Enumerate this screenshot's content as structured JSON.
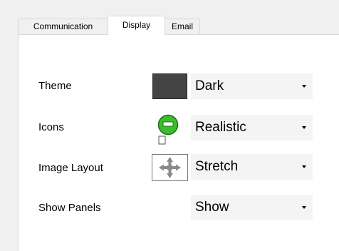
{
  "tabs": [
    {
      "label": "Communication",
      "active": false
    },
    {
      "label": "Display",
      "active": true
    },
    {
      "label": "Email",
      "active": false
    }
  ],
  "settings": {
    "theme": {
      "label": "Theme",
      "value": "Dark",
      "preview_color": "#444444"
    },
    "icons": {
      "label": "Icons",
      "value": "Realistic",
      "preview_icon": "green-monitor-icon"
    },
    "image_layout": {
      "label": "Image Layout",
      "value": "Stretch",
      "preview_icon": "stretch-arrows-icon"
    },
    "show_panels": {
      "label": "Show Panels",
      "value": "Show"
    }
  },
  "colors": {
    "window_background": "#f0f0f0",
    "panel_background": "#ffffff",
    "tab_border": "#d9d9d9",
    "combo_background": "#f4f4f4",
    "icon_green": "#3cbe2c"
  }
}
